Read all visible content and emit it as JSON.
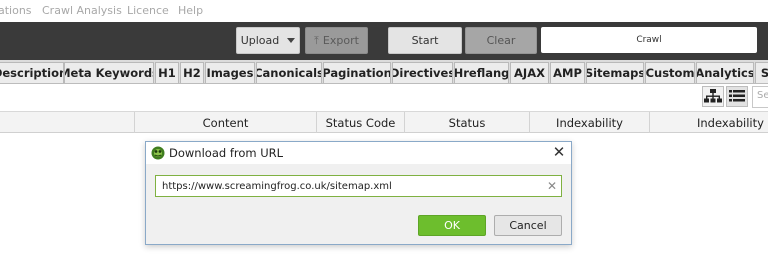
{
  "menu": {
    "items": [
      "ations",
      "Crawl Analysis",
      "Licence",
      "Help"
    ]
  },
  "toolbar": {
    "upload_label": "Upload",
    "export_label": "Export",
    "start_label": "Start",
    "clear_label": "Clear",
    "crawl_field_value": "Crawl"
  },
  "tabs": [
    "Description",
    "Meta Keywords",
    "H1",
    "H2",
    "Images",
    "Canonicals",
    "Pagination",
    "Directives",
    "Hreflang",
    "AJAX",
    "AMP",
    "Sitemaps",
    "Custom",
    "Analytics",
    "S"
  ],
  "filter": {
    "search_placeholder": "Se"
  },
  "columns": [
    "Content",
    "Status Code",
    "Status",
    "Indexability",
    "Indexability Sta"
  ],
  "dialog": {
    "title": "Download from URL",
    "url_value": "https://www.screamingfrog.co.uk/sitemap.xml",
    "ok_label": "OK",
    "cancel_label": "Cancel"
  },
  "colors": {
    "toolbar_bg": "#3a3a3a",
    "ok_green": "#6dbe2d",
    "input_border_green": "#7fb141"
  }
}
